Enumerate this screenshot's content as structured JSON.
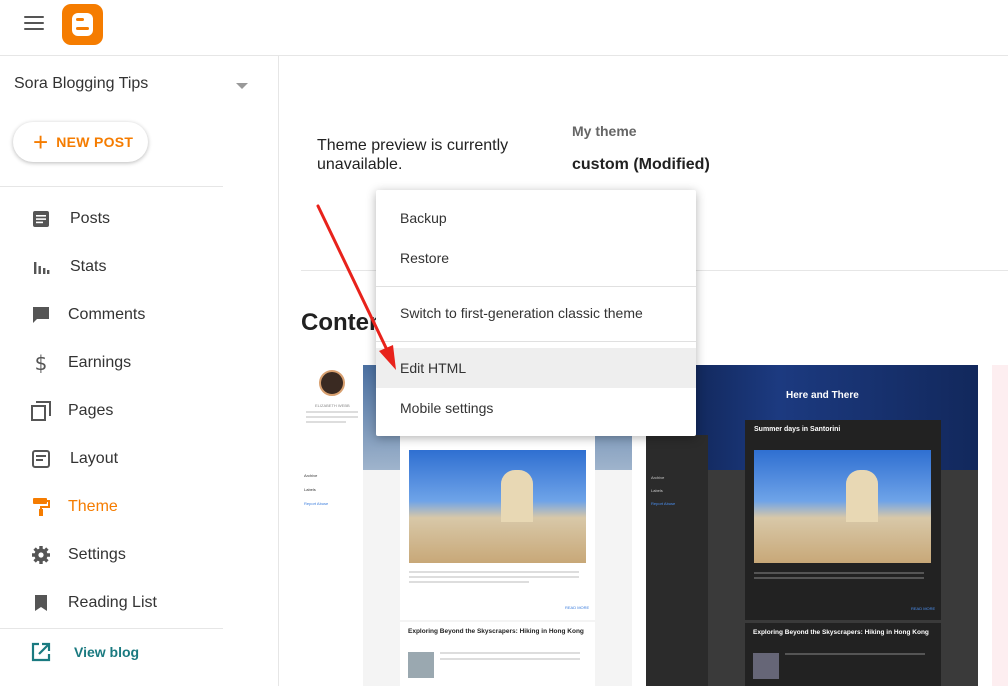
{
  "sidebar": {
    "blog_name": "Sora Blogging Tips",
    "new_post_label": "NEW POST",
    "nav": [
      {
        "label": "Posts",
        "icon": "posts-icon"
      },
      {
        "label": "Stats",
        "icon": "stats-icon"
      },
      {
        "label": "Comments",
        "icon": "comments-icon"
      },
      {
        "label": "Earnings",
        "icon": "dollar-icon"
      },
      {
        "label": "Pages",
        "icon": "pages-icon"
      },
      {
        "label": "Layout",
        "icon": "layout-icon"
      },
      {
        "label": "Theme",
        "icon": "paint-roller-icon",
        "active": true
      },
      {
        "label": "Settings",
        "icon": "gear-icon"
      },
      {
        "label": "Reading List",
        "icon": "bookmark-icon"
      }
    ],
    "view_blog_label": "View blog"
  },
  "main": {
    "preview_message": "Theme preview is currently unavailable.",
    "my_theme_label": "My theme",
    "my_theme_name": "custom (Modified)",
    "content_heading": "Conten"
  },
  "menu": {
    "items": [
      "Backup",
      "Restore",
      "Switch to first-generation classic theme",
      "Edit HTML",
      "Mobile settings"
    ],
    "highlighted": "Edit HTML"
  },
  "theme_cards": {
    "card2_title": "Here and There",
    "post1_title": "Summer days in Santorini",
    "post2_title": "Exploring Beyond the Skyscrapers: Hiking in Hong Kong",
    "author_name": "ELIZABETH WEBB",
    "sidebar_links": [
      "Archive",
      "Labels",
      "Report Abuse"
    ],
    "read_more": "READ MORE"
  },
  "colors": {
    "accent": "#f57c00",
    "view_blog": "#1a7a80",
    "arrow": "#e8221b"
  }
}
